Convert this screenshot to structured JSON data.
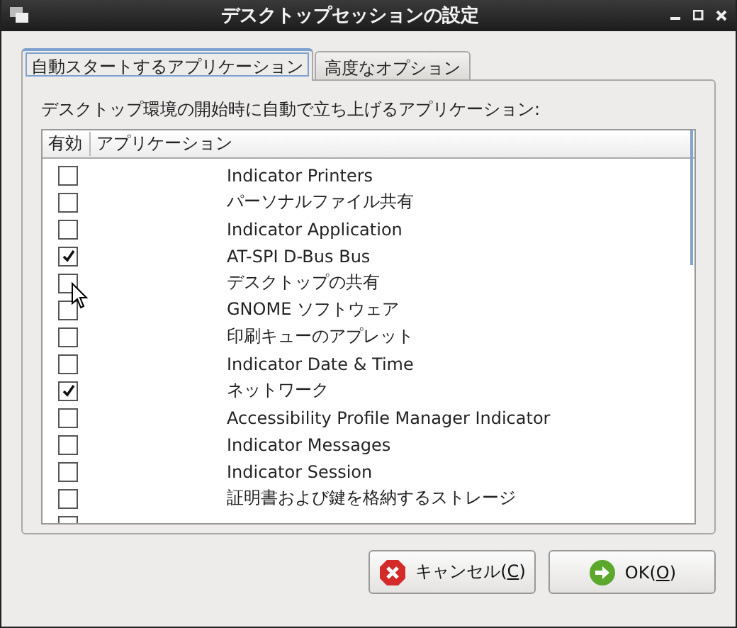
{
  "window": {
    "title": "デスクトップセッションの設定"
  },
  "tabs": [
    {
      "label": "自動スタートするアプリケーション",
      "selected": true
    },
    {
      "label": "高度なオプション",
      "selected": false
    }
  ],
  "description": "デスクトップ環境の開始時に自動で立ち上げるアプリケーション:",
  "table": {
    "columns": [
      "有効",
      "アプリケーション"
    ],
    "rows": [
      {
        "name": "Indicator Printers",
        "checked": false
      },
      {
        "name": "パーソナルファイル共有",
        "checked": false
      },
      {
        "name": "Indicator Application",
        "checked": false
      },
      {
        "name": "AT-SPI D-Bus Bus",
        "checked": true
      },
      {
        "name": "デスクトップの共有",
        "checked": false
      },
      {
        "name": "GNOME ソフトウェア",
        "checked": false
      },
      {
        "name": "印刷キューのアプレット",
        "checked": false
      },
      {
        "name": "Indicator Date & Time",
        "checked": false
      },
      {
        "name": "ネットワーク",
        "checked": true
      },
      {
        "name": "Accessibility Profile Manager Indicator",
        "checked": false
      },
      {
        "name": "Indicator Messages",
        "checked": false
      },
      {
        "name": "Indicator Session",
        "checked": false
      },
      {
        "name": "証明書および鍵を格納するストレージ",
        "checked": false
      }
    ]
  },
  "buttons": [
    {
      "kind": "cancel",
      "before": "キャンセル(",
      "key": "C",
      "after": ")"
    },
    {
      "kind": "ok",
      "before": "OK(",
      "key": "O",
      "after": ")"
    }
  ]
}
